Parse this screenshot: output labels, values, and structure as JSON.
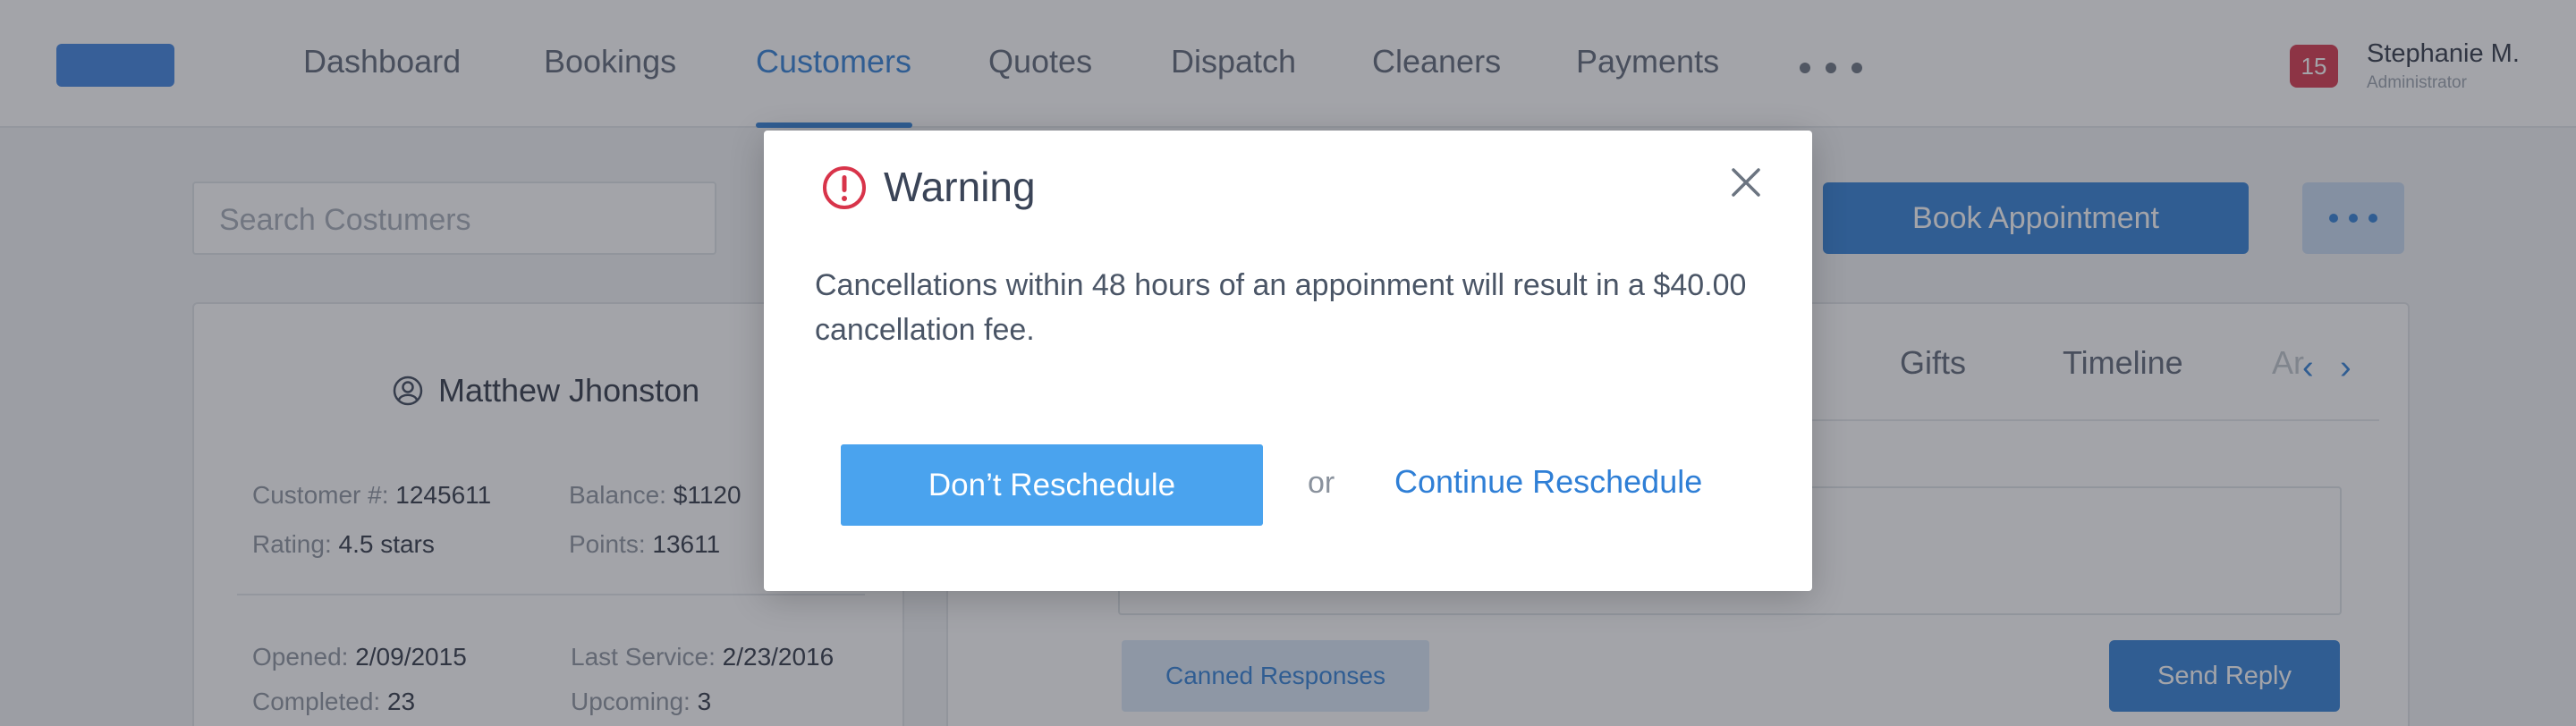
{
  "nav": {
    "items": [
      "Dashboard",
      "Bookings",
      "Customers",
      "Quotes",
      "Dispatch",
      "Cleaners",
      "Payments"
    ],
    "active": "Customers"
  },
  "user": {
    "badge_count": "15",
    "name": "Stephanie M.",
    "role": "Administrator"
  },
  "search": {
    "placeholder": "Search Costumers"
  },
  "actions": {
    "book_label": "Book Appointment"
  },
  "customer": {
    "name": "Matthew Jhonston",
    "customer_no_label": "Customer #:",
    "customer_no": "1245611",
    "balance_label": "Balance:",
    "balance": "$1120",
    "rating_label": "Rating:",
    "rating": "4.5 stars",
    "points_label": "Points:",
    "points": "13611",
    "opened_label": "Opened:",
    "opened": "2/09/2015",
    "last_service_label": "Last Service:",
    "last_service": "2/23/2016",
    "completed_label": "Completed:",
    "completed": "23",
    "upcoming_label": "Upcoming:",
    "upcoming": "3"
  },
  "tabs": {
    "gifts": "Gifts",
    "timeline": "Timeline",
    "truncated": "Ar"
  },
  "reply": {
    "canned_label": "Canned Responses",
    "send_label": "Send Reply"
  },
  "modal": {
    "title": "Warning",
    "message": "Cancellations within 48 hours of an appoinment will result in a $40.00 cancellation fee.",
    "primary_label": "Don’t Reschedule",
    "or_text": "or",
    "secondary_label": "Continue Reschedule"
  },
  "colors": {
    "accent": "#2f7fd6",
    "primary_button": "#4aa3ee",
    "warning": "#d8344a",
    "overlay": "#32364073"
  }
}
